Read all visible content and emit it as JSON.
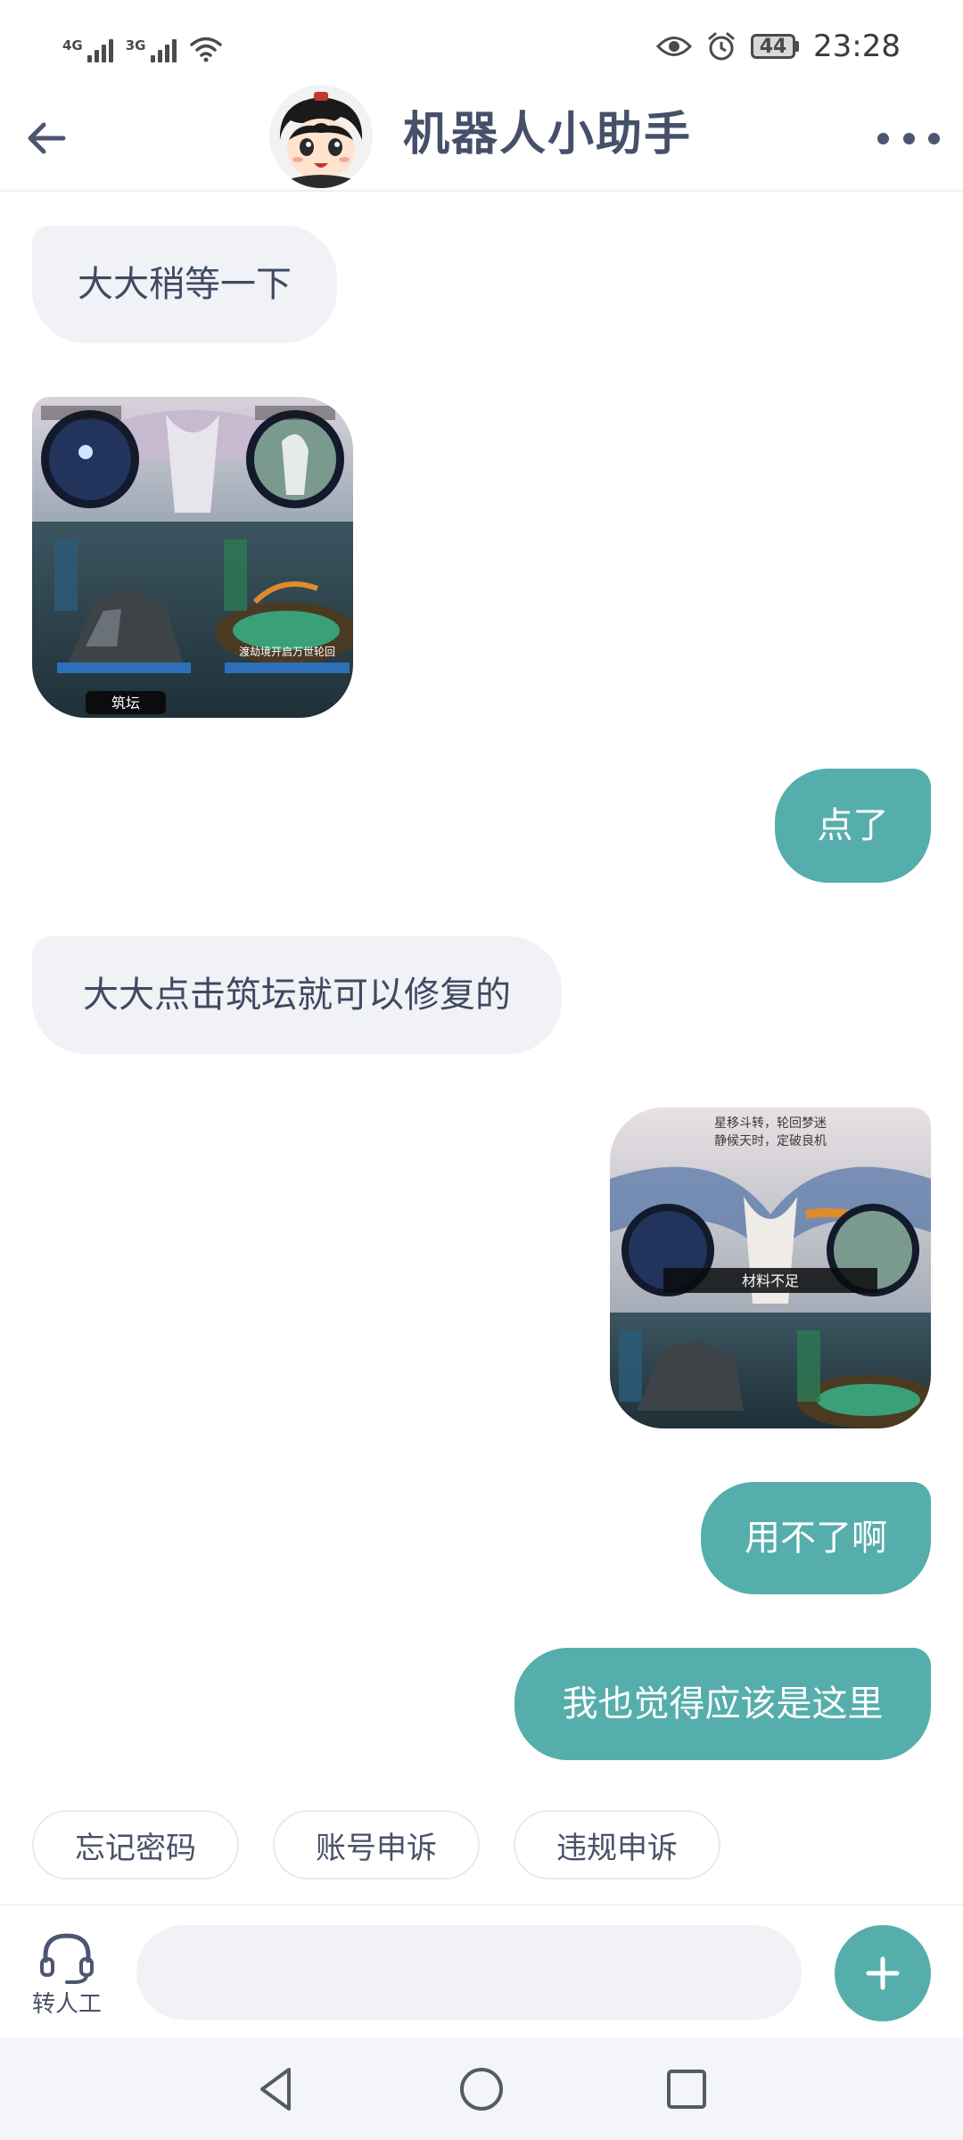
{
  "status_bar": {
    "network1": "4G",
    "network2": "3G",
    "battery": "44",
    "time": "23:28",
    "icons": [
      "signal-icon",
      "wifi-icon",
      "eye-icon",
      "alarm-icon",
      "battery-icon"
    ]
  },
  "header": {
    "title": "机器人小助手",
    "icons": [
      "back-arrow-icon",
      "more-icon"
    ]
  },
  "messages": {
    "m1": "大大稍等一下",
    "m2_image": "game-screenshot-thumbnail",
    "m3": "点了",
    "m4": "大大点击筑坛就可以修复的",
    "m5_image": "game-screenshot-thumbnail",
    "m6": "用不了啊",
    "m7": "我也觉得应该是这里"
  },
  "image_texts": {
    "forge": "筑坛",
    "reincarnation": "渡劫境开启万世轮回",
    "insufficient": "材料不足",
    "poem1": "星移斗转，轮回梦迷",
    "poem2": "静候天时，定破良机"
  },
  "quick_replies": [
    "忘记密码",
    "账号申诉",
    "违规申诉"
  ],
  "input_bar": {
    "transfer_label": "转人工",
    "input_placeholder": "",
    "icons": [
      "headset-icon",
      "plus-icon"
    ]
  },
  "nav": {
    "icons": [
      "back-triangle-icon",
      "home-circle-icon",
      "recents-square-icon"
    ]
  },
  "colors": {
    "accent": "#55aeac",
    "bot_bubble": "#f0f2f6",
    "text": "#3f4a62"
  }
}
